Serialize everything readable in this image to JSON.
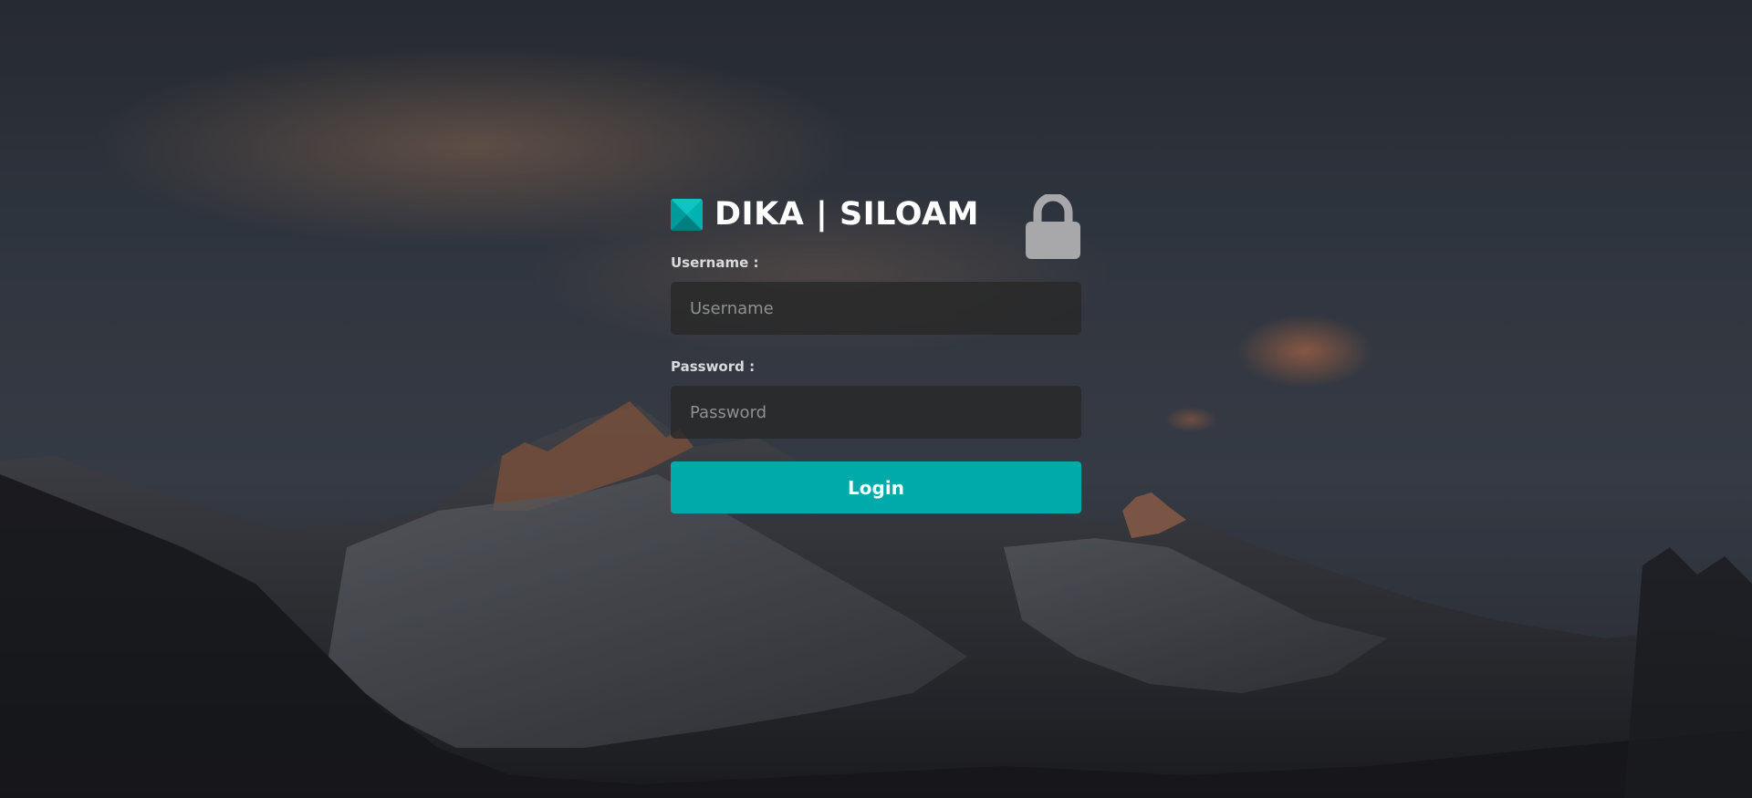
{
  "brand": {
    "title": "DIKA | SILOAM",
    "logo_icon": "diamond-logo-icon",
    "logo_color": "#00a8a8"
  },
  "lock_icon": "lock-icon",
  "form": {
    "username_label": "Username :",
    "username_placeholder": "Username",
    "username_value": "",
    "password_label": "Password :",
    "password_placeholder": "Password",
    "password_value": "",
    "login_label": "Login"
  },
  "colors": {
    "accent": "#00aaaa",
    "input_bg": "#282828",
    "text": "#ffffff"
  },
  "background": "mountain-sunset-image"
}
